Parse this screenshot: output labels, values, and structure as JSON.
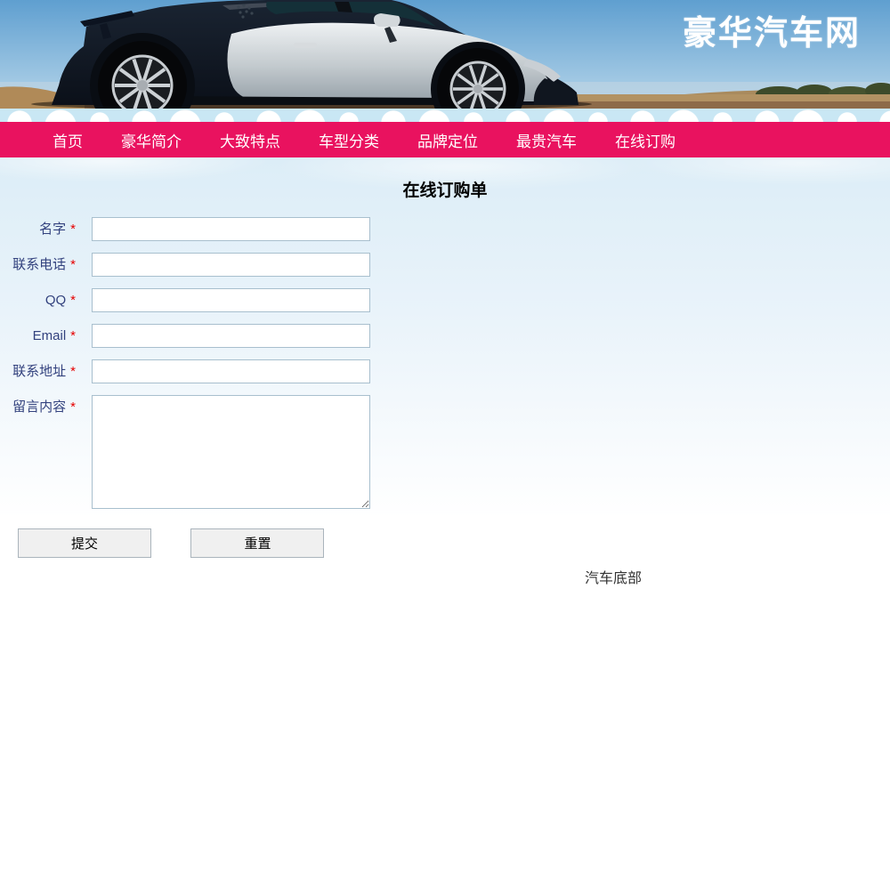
{
  "site": {
    "title": "豪华汽车网"
  },
  "nav": {
    "items": [
      {
        "label": "首页"
      },
      {
        "label": "豪华简介"
      },
      {
        "label": "大致特点"
      },
      {
        "label": "车型分类"
      },
      {
        "label": "品牌定位"
      },
      {
        "label": "最贵汽车"
      },
      {
        "label": "在线订购"
      }
    ]
  },
  "order_form": {
    "title": "在线订购单",
    "required_marker": "*",
    "fields": [
      {
        "label": "名字"
      },
      {
        "label": "联系电话"
      },
      {
        "label": "QQ"
      },
      {
        "label": "Email"
      },
      {
        "label": "联系地址"
      },
      {
        "label": "留言内容"
      }
    ],
    "submit_label": "提交",
    "reset_label": "重置"
  },
  "footer": {
    "text": "汽车底部"
  },
  "colors": {
    "nav_background": "#e9125f",
    "field_label": "#33427e",
    "required_marker": "#e60000",
    "header_title": "#ffffff",
    "content_gradient_top": "#dcedf7",
    "cloud_strip": "#c9e7f4"
  }
}
